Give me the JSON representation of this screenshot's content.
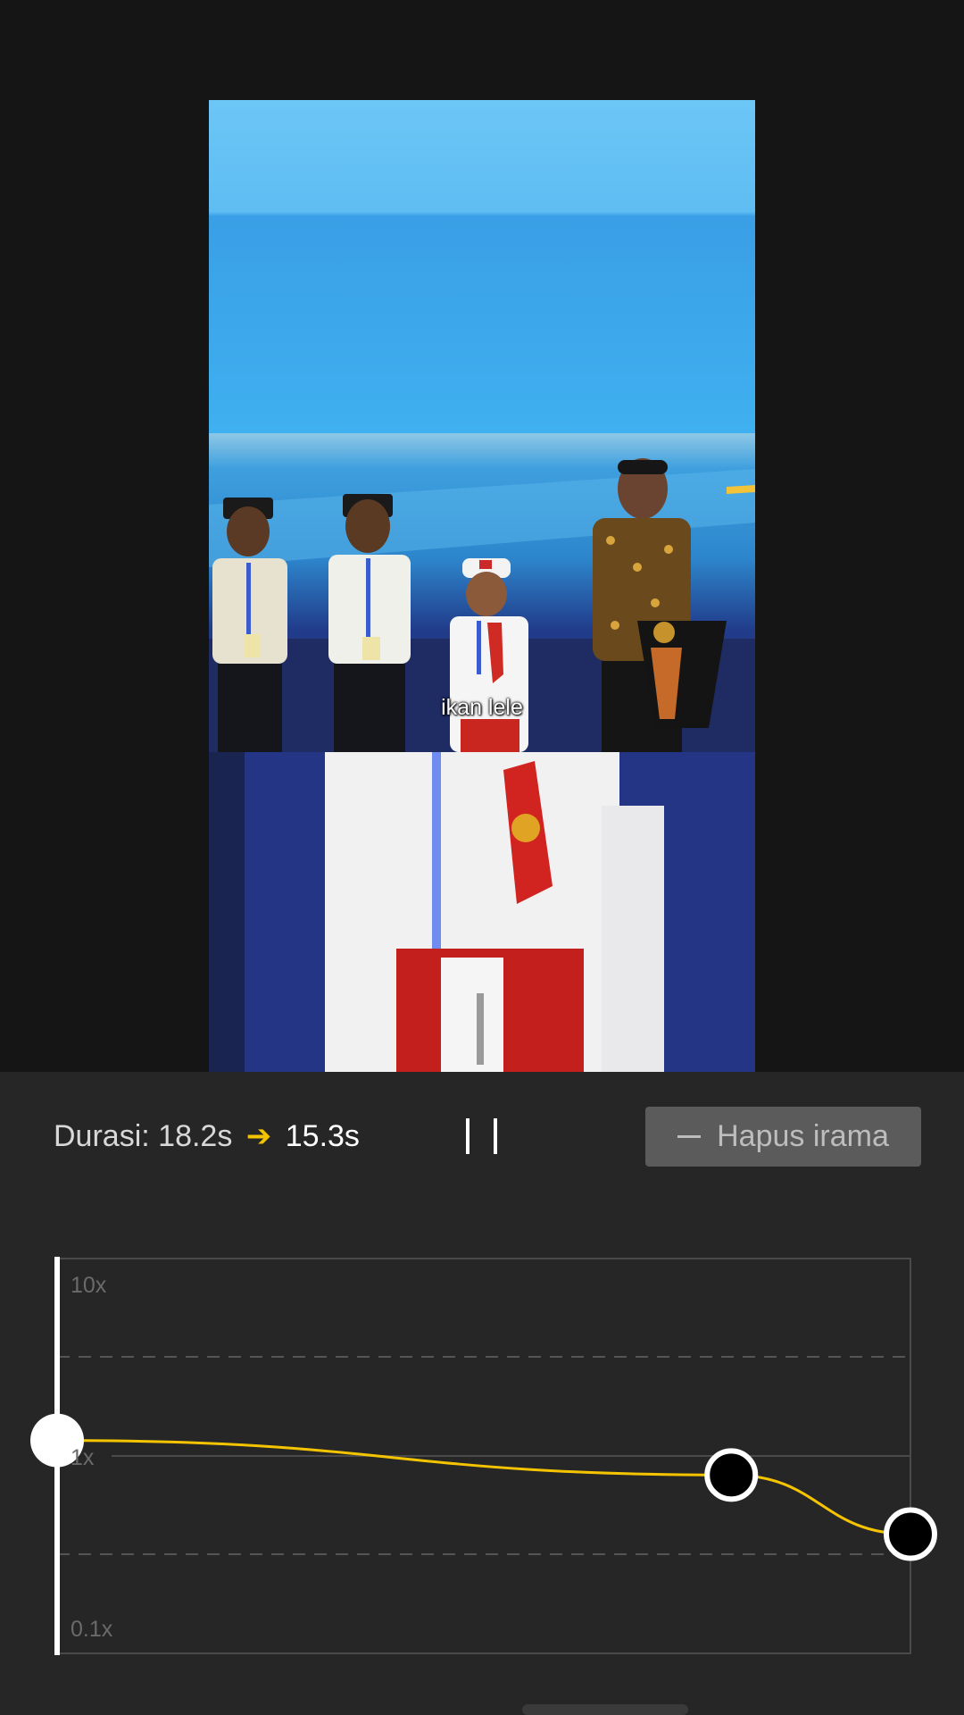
{
  "video": {
    "caption": "ikan lele"
  },
  "controls": {
    "duration_label": "Durasi:",
    "duration_original": "18.2s",
    "duration_new": "15.3s",
    "reset_label": "Hapus irama"
  },
  "speed_curve": {
    "axis_labels": {
      "top": "10x",
      "middle": "1x",
      "bottom": "0.1x"
    },
    "control_points": [
      {
        "time_fraction": 0.0,
        "speed": 1.2,
        "state": "selected"
      },
      {
        "time_fraction": 0.79,
        "speed": 0.8,
        "state": "normal"
      },
      {
        "time_fraction": 1.0,
        "speed": 0.4,
        "state": "normal"
      }
    ],
    "playhead_fraction": 0.0
  },
  "colors": {
    "curve": "#f5c400",
    "panel_background": "#262626",
    "accent_arrow": "#f5c400"
  }
}
